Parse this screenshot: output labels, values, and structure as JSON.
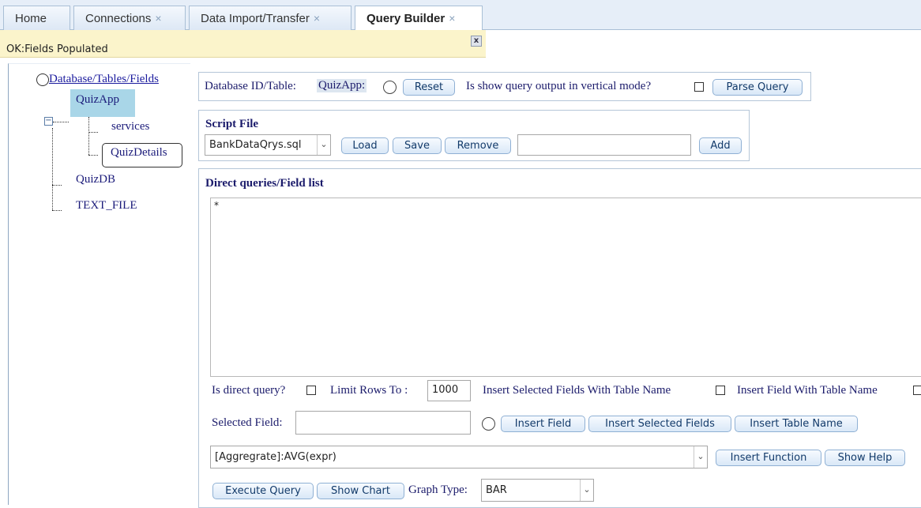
{
  "tabs": [
    {
      "label": "Home",
      "closable": false
    },
    {
      "label": "Connections",
      "closable": true
    },
    {
      "label": "Data Import/Transfer",
      "closable": true
    },
    {
      "label": "Query Builder",
      "closable": true,
      "active": true
    }
  ],
  "tab_close_glyph": "×",
  "status": {
    "message": "OK:Fields Populated",
    "close_glyph": "x"
  },
  "tree": {
    "root_label": "Database/Tables/Fields",
    "nodes": [
      {
        "label": "QuizApp",
        "expanded": true,
        "selected": true,
        "children": [
          {
            "label": "services"
          },
          {
            "label": "QuizDetails",
            "focused": true
          }
        ]
      },
      {
        "label": "QuizDB"
      },
      {
        "label": "TEXT_FILE"
      }
    ],
    "expander_glyph": "−"
  },
  "db_bar": {
    "label": "Database ID/Table:",
    "value": "QuizApp:",
    "reset_label": "Reset",
    "vertical_label": "Is show query output in vertical mode?",
    "parse_label": "Parse Query"
  },
  "script_file": {
    "title": "Script File",
    "selected": "BankDataQrys.sql",
    "load_label": "Load",
    "save_label": "Save",
    "remove_label": "Remove",
    "name_value": "",
    "add_label": "Add"
  },
  "queries": {
    "title": "Direct queries/Field list",
    "text": "*",
    "direct_query_label": "Is direct query?",
    "limit_label": "Limit Rows To :",
    "limit_value": "1000",
    "insert_selected_with_table_label": "Insert Selected Fields With Table Name",
    "insert_field_with_table_label": "Insert Field With Table Name",
    "selected_field_label": "Selected Field:",
    "selected_field_value": "",
    "insert_field_label": "Insert Field",
    "insert_selected_fields_label": "Insert Selected Fields",
    "insert_table_name_label": "Insert Table Name",
    "function_selected": "[Aggregrate]:AVG(expr)",
    "insert_function_label": "Insert Function",
    "show_help_label": "Show Help",
    "execute_label": "Execute Query",
    "show_chart_label": "Show Chart",
    "graph_type_label": "Graph Type:",
    "graph_type_value": "BAR"
  },
  "colors": {
    "status_bg": "#fbf4cb",
    "tree_selected": "#a9d6e8",
    "text": "#1b1b6b",
    "button_border": "#8fb0d4"
  }
}
